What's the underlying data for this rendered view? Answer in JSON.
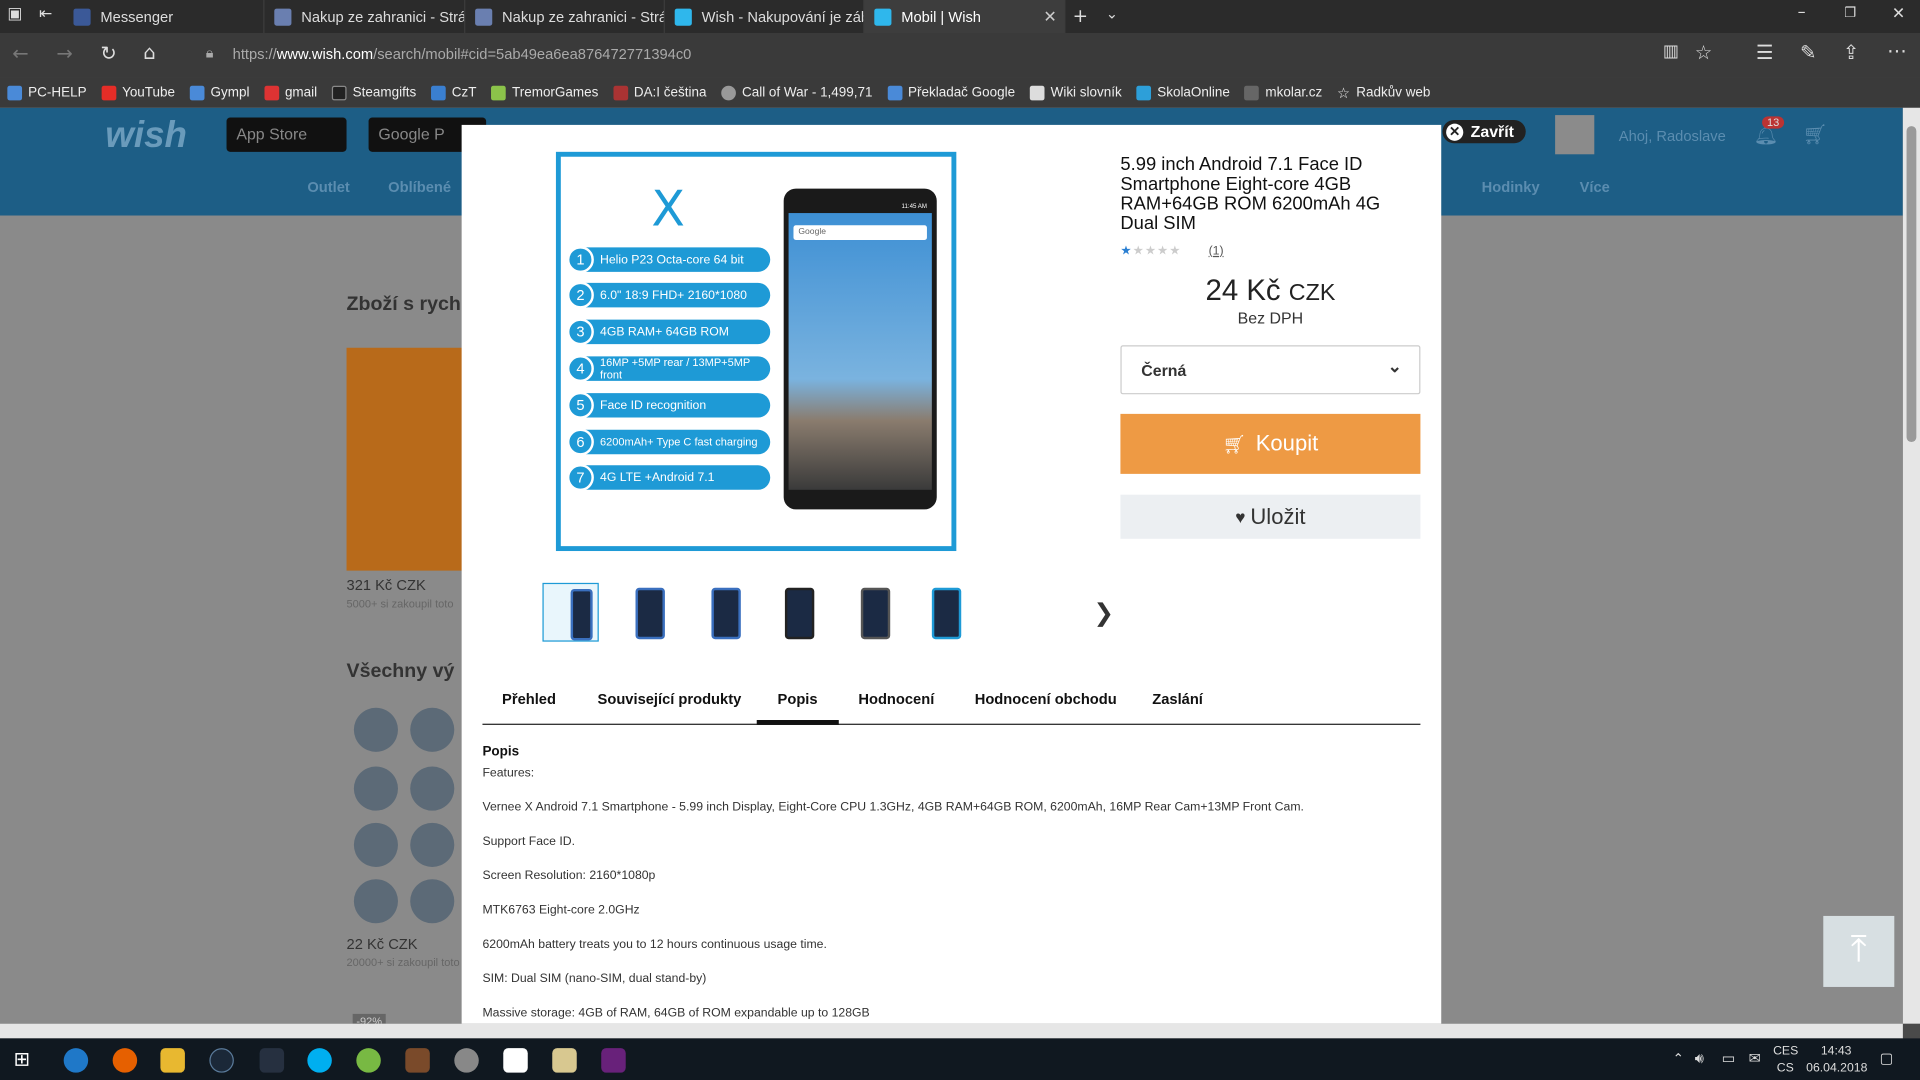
{
  "browser": {
    "tabs": [
      {
        "label": "Messenger",
        "color": "#3b5998"
      },
      {
        "label": "Nakup ze zahranici - Stránk",
        "color": "#6a7fb0"
      },
      {
        "label": "Nakup ze zahranici - Stránk",
        "color": "#6a7fb0"
      },
      {
        "label": "Wish - Nakupování je zábav",
        "color": "#2fb7ec"
      },
      {
        "label": "Mobil | Wish",
        "color": "#2fb7ec",
        "active": true
      }
    ],
    "url_prefix": "https://",
    "url_domain": "www.wish.com",
    "url_rest": "/search/mobil#cid=5ab49ea6ea876472771394c0",
    "bookmarks": [
      {
        "label": "PC-HELP",
        "color": "#4a8ad8"
      },
      {
        "label": "YouTube",
        "color": "#e52d27"
      },
      {
        "label": "Gympl",
        "color": "#4a8ad8"
      },
      {
        "label": "gmail",
        "color": "#d33"
      },
      {
        "label": "Steamgifts",
        "color": "#222"
      },
      {
        "label": "CzT",
        "color": "#3a7fd0"
      },
      {
        "label": "TremorGames",
        "color": "#8bc34a"
      },
      {
        "label": "DA:I čeština",
        "color": "#a33"
      },
      {
        "label": "Call of War - 1,499,71",
        "color": "#999"
      },
      {
        "label": "Překladač Google",
        "color": "#4a8ad8"
      },
      {
        "label": "Wiki slovník",
        "color": "#ddd"
      },
      {
        "label": "SkolaOnline",
        "color": "#2d9fd9"
      },
      {
        "label": "mkolar.cz",
        "color": "#666"
      },
      {
        "label": "Radkův web",
        "color": "#ddd"
      }
    ]
  },
  "site": {
    "logo": "wish",
    "stores": [
      "App Store",
      "Google P"
    ],
    "nav": [
      "Outlet",
      "Oblíbené",
      "Hodinky",
      "Více"
    ],
    "greeting": "Ahoj, Radoslave",
    "notif_count": "13",
    "bg_heading_1": "Zboží s rych",
    "bg_price_1": "321 Kč CZK",
    "bg_sold_1": "5000+ si zakoupil toto",
    "bg_heading_2": "Všechny vý",
    "bg_price_2": "22 Kč CZK",
    "bg_sold_2": "20000+ si zakoupil toto",
    "bg_discount": "-92%"
  },
  "modal": {
    "close_label": "Zavřít",
    "product_image": {
      "features": [
        {
          "n": "1",
          "text": "Helio P23 Octa-core 64 bit"
        },
        {
          "n": "2",
          "text": "6.0\" 18:9 FHD+ 2160*1080"
        },
        {
          "n": "3",
          "text": "4GB RAM+ 64GB ROM"
        },
        {
          "n": "4",
          "text": "16MP +5MP rear / 13MP+5MP front"
        },
        {
          "n": "5",
          "text": "Face ID recognition"
        },
        {
          "n": "6",
          "text": "6200mAh+ Type C fast charging"
        },
        {
          "n": "7",
          "text": "4G LTE +Android 7.1"
        }
      ],
      "logo_letter": "X",
      "search_placeholder": "Google",
      "status_time": "11:45 AM"
    },
    "title": "5.99 inch Android 7.1 Face ID Smartphone Eight-core 4GB RAM+64GB ROM 6200mAh 4G Dual SIM",
    "rating_count": "(1)",
    "price_amount": "24 Kč",
    "price_currency": "CZK",
    "vat_note": "Bez DPH",
    "color_option": "Černá",
    "buy_label": "Koupit",
    "save_label": "Uložit",
    "tabs": [
      "Přehled",
      "Související produkty",
      "Popis",
      "Hodnocení",
      "Hodnocení obchodu",
      "Zaslání"
    ],
    "active_tab": "Popis",
    "description": {
      "heading": "Popis",
      "lines": [
        "Features:",
        "Vernee X Android 7.1 Smartphone - 5.99 inch Display, Eight-Core CPU 1.3GHz, 4GB RAM+64GB ROM, 6200mAh, 16MP Rear Cam+13MP Front Cam.",
        "Support Face ID.",
        "Screen Resolution: 2160*1080p",
        "MTK6763 Eight-core 2.0GHz",
        "6200mAh battery treats you to 12 hours continuous usage time.",
        "SIM: Dual SIM (nano-SIM, dual stand-by)",
        "Massive storage: 4GB of RAM, 64GB of ROM expandable up to 128GB"
      ]
    }
  },
  "taskbar": {
    "lang_1": "CES",
    "lang_2": "CS",
    "time": "14:43",
    "date": "06.04.2018"
  }
}
